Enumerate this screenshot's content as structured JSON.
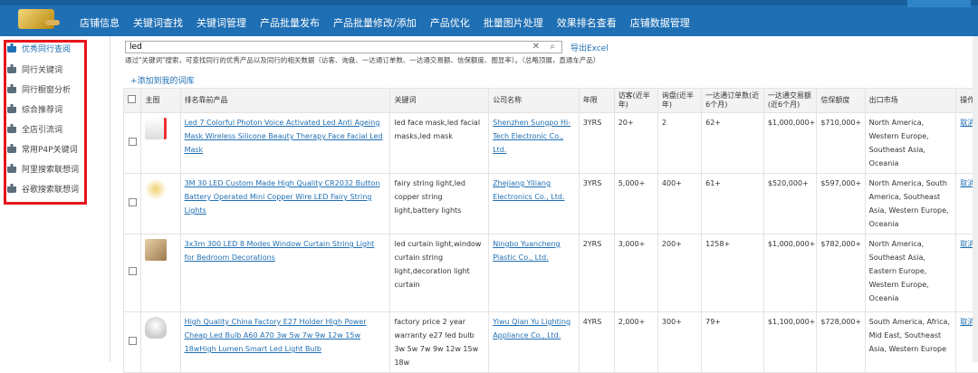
{
  "nav": [
    "店铺信息",
    "关键词查找",
    "关键词管理",
    "产品批量发布",
    "产品批量修改/添加",
    "产品优化",
    "批量图片处理",
    "效果排名查看",
    "店铺数据管理"
  ],
  "sidebar": [
    "优秀同行查阅",
    "同行关键词",
    "同行橱窗分析",
    "综合推荐词",
    "全店引流词",
    "常用P4P关键词",
    "阿里搜索联想词",
    "谷歌搜索联想词"
  ],
  "search": {
    "value": "led"
  },
  "export_label": "导出Excel",
  "hint": "通过\"关键词\"搜索，可查找同行的优秀产品以及同行的相关数据（访客、询盘、一达通订单数、一达通交易额、信保额度、图显率）。（总略顶展，直通车产品）",
  "add_label": "+添加到我的词库",
  "columns": [
    "主图",
    "排名靠前产品",
    "关键词",
    "公司名称",
    "年限",
    "访客(近半年)",
    "询盘(近半年)",
    "一达通订单数(近6个月)",
    "一达通交易额(近6个月)",
    "信保额度",
    "出口市场",
    "操作"
  ],
  "rows": [
    {
      "product": "Led 7 Colorful Photon Voice Activated Led Anti Ageing Mask Wireless Silicone Beauty Therapy Face Facial Led Mask",
      "keywords": "led face mask,led facial masks,led mask",
      "company": "Shenzhen Sungpo Hi-Tech Electronic Co., Ltd.",
      "years": "3YRS",
      "visitors": "20+",
      "inquiries": "2",
      "orders": "62+",
      "amount": "$1,000,000+",
      "credit": "$710,000+",
      "markets": "North America, Western Europe, Southeast Asia, Oceania",
      "action": "取消"
    },
    {
      "product": "3M 30 LED Custom Made High Quality CR2032 Button Battery Operated Mini Copper Wire LED Fairy String Lights",
      "keywords": "fairy string light,led copper string light,battery lights",
      "company": "Zhejiang Yiliang Electronics Co., Ltd.",
      "years": "3YRS",
      "visitors": "5,000+",
      "inquiries": "400+",
      "orders": "61+",
      "amount": "$520,000+",
      "credit": "$597,000+",
      "markets": "North America, South America, Southeast Asia, Western Europe, Oceania",
      "action": "取消"
    },
    {
      "product": "3x3m 300 LED 8 Modes Window Curtain String Light for Bedroom Decorations",
      "keywords": "led curtain light,window curtain string light,decoration light curtain",
      "company": "Ningbo Yuancheng Plastic Co., Ltd.",
      "years": "2YRS",
      "visitors": "3,000+",
      "inquiries": "200+",
      "orders": "1258+",
      "amount": "$1,000,000+",
      "credit": "$782,000+",
      "markets": "North America, Southeast Asia, Eastern Europe, Western Europe, Oceania",
      "action": "取消"
    },
    {
      "product": "High Quality China Factory E27 Holder High Power Cheap Led Bulb A60 A70 3w 5w 7w 9w 12w 15w 18wHigh Lumen Smart Led Light Bulb",
      "keywords": "factory price 2 year warranty e27 led bulb 3w 5w 7w 9w 12w 15w 18w",
      "company": "Yiwu Qian Yu Lighting Appliance Co., Ltd.",
      "years": "4YRS",
      "visitors": "2,000+",
      "inquiries": "300+",
      "orders": "79+",
      "amount": "$1,100,000+",
      "credit": "$728,000+",
      "markets": "South America, Africa, Mid East, Southeast Asia, Western Europe",
      "action": "取消"
    }
  ]
}
